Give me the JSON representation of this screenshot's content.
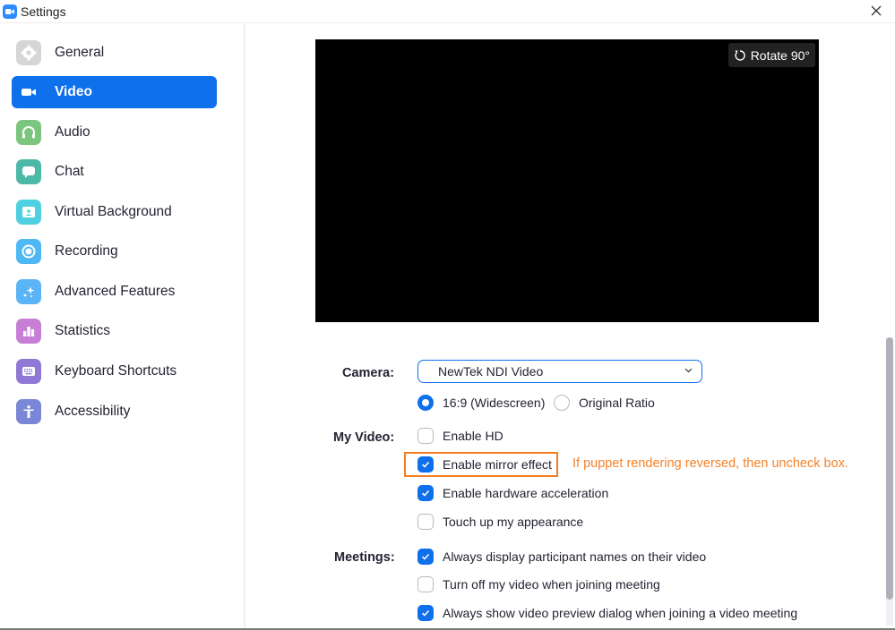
{
  "window": {
    "title": "Settings",
    "close_icon": "close-icon"
  },
  "sidebar": {
    "items": [
      {
        "label": "General",
        "icon": "gear-icon",
        "color": "#d6d6d8",
        "active": false
      },
      {
        "label": "Video",
        "icon": "video-camera-icon",
        "color": "#0e71eb",
        "active": true
      },
      {
        "label": "Audio",
        "icon": "headphones-icon",
        "color": "#7cc57e",
        "active": false
      },
      {
        "label": "Chat",
        "icon": "chat-bubble-icon",
        "color": "#4cb8a8",
        "active": false
      },
      {
        "label": "Virtual Background",
        "icon": "person-portrait-icon",
        "color": "#4fd0e0",
        "active": false
      },
      {
        "label": "Recording",
        "icon": "record-circle-icon",
        "color": "#4fb8f4",
        "active": false
      },
      {
        "label": "Advanced Features",
        "icon": "sparkle-icon",
        "color": "#5ab4f6",
        "active": false
      },
      {
        "label": "Statistics",
        "icon": "bar-chart-icon",
        "color": "#c77fd6",
        "active": false
      },
      {
        "label": "Keyboard Shortcuts",
        "icon": "keyboard-icon",
        "color": "#8f78d6",
        "active": false
      },
      {
        "label": "Accessibility",
        "icon": "accessibility-person-icon",
        "color": "#7a87d6",
        "active": false
      }
    ]
  },
  "preview": {
    "rotate_label": "Rotate 90°",
    "rotate_icon": "rotate-icon"
  },
  "camera": {
    "label": "Camera:",
    "selected": "NewTek NDI Video",
    "aspect_options": [
      {
        "label": "16:9 (Widescreen)",
        "checked": true
      },
      {
        "label": "Original Ratio",
        "checked": false
      }
    ]
  },
  "my_video": {
    "label": "My Video:",
    "options": [
      {
        "label": "Enable HD",
        "checked": false
      },
      {
        "label": "Enable mirror effect",
        "checked": true
      },
      {
        "label": "Enable hardware acceleration",
        "checked": true
      },
      {
        "label": "Touch up my appearance",
        "checked": false
      }
    ]
  },
  "annotation": {
    "text": "If puppet rendering reversed, then uncheck box.",
    "color": "#f5822a"
  },
  "meetings": {
    "label": "Meetings:",
    "options": [
      {
        "label": "Always display participant names on their video",
        "checked": true
      },
      {
        "label": "Turn off my video when joining meeting",
        "checked": false
      },
      {
        "label": "Always show video preview dialog when joining a video meeting",
        "checked": true
      }
    ]
  },
  "colors": {
    "accent": "#0e71eb",
    "highlight_border": "#f57c1f"
  }
}
